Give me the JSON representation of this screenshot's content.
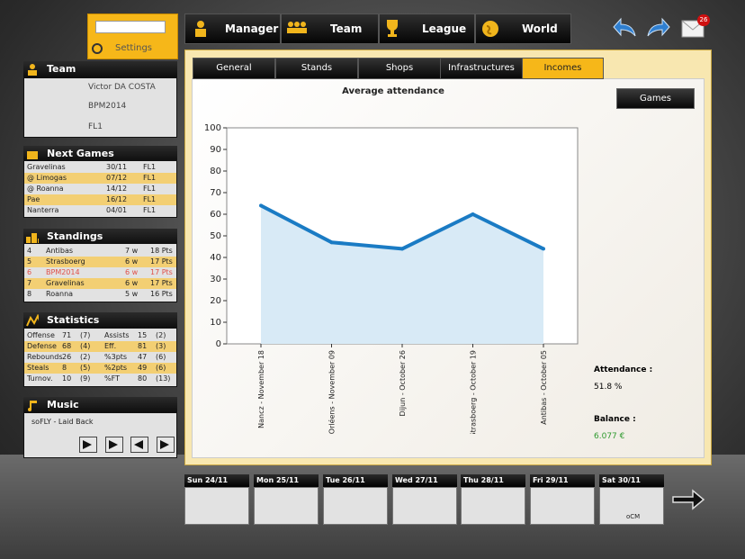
{
  "settings": {
    "label": "Settings"
  },
  "nav": {
    "manager": "Manager",
    "team": "Team",
    "league": "League",
    "world": "World"
  },
  "mail": {
    "count": "26"
  },
  "team_panel": {
    "title": "Team",
    "manager_name": "Victor DA COSTA",
    "team_name": "BPM2014",
    "league": "FL1"
  },
  "next_games": {
    "title": "Next Games",
    "rows": [
      {
        "opponent": "Gravelinas",
        "date": "30/11",
        "league": "FL1"
      },
      {
        "opponent": "@ Limogas",
        "date": "07/12",
        "league": "FL1"
      },
      {
        "opponent": "@ Roanna",
        "date": "14/12",
        "league": "FL1"
      },
      {
        "opponent": "Pae",
        "date": "16/12",
        "league": "FL1"
      },
      {
        "opponent": "Nanterra",
        "date": "04/01",
        "league": "FL1"
      }
    ]
  },
  "standings": {
    "title": "Standings",
    "rows": [
      {
        "rank": "4",
        "team": "Antibas",
        "wins": "7 w",
        "pts": "18 Pts"
      },
      {
        "rank": "5",
        "team": "Strasboerg",
        "wins": "6 w",
        "pts": "17 Pts"
      },
      {
        "rank": "6",
        "team": "BPM2014",
        "wins": "6 w",
        "pts": "17 Pts"
      },
      {
        "rank": "7",
        "team": "Gravelinas",
        "wins": "6 w",
        "pts": "17 Pts"
      },
      {
        "rank": "8",
        "team": "Roanna",
        "wins": "5 w",
        "pts": "16 Pts"
      }
    ]
  },
  "statistics": {
    "title": "Statistics",
    "rows": [
      {
        "l": "Offense",
        "v": "71",
        "r": "(7)",
        "l2": "Assists",
        "v2": "15",
        "r2": "(2)"
      },
      {
        "l": "Defense",
        "v": "68",
        "r": "(4)",
        "l2": "Eff.",
        "v2": "81",
        "r2": "(3)"
      },
      {
        "l": "Rebounds",
        "v": "26",
        "r": "(2)",
        "l2": "%3pts",
        "v2": "47",
        "r2": "(6)"
      },
      {
        "l": "Steals",
        "v": "8",
        "r": "(5)",
        "l2": "%2pts",
        "v2": "49",
        "r2": "(6)"
      },
      {
        "l": "Turnov.",
        "v": "10",
        "r": "(9)",
        "l2": "%FT",
        "v2": "80",
        "r2": "(13)"
      }
    ]
  },
  "music": {
    "title": "Music",
    "track": "soFLY - Laid Back"
  },
  "tabs": [
    "General",
    "Stands",
    "Shops",
    "Infrastructures",
    "Incomes"
  ],
  "games_button": "Games",
  "summary": {
    "attendance_label": "Attendance :",
    "attendance_value": "51.8 %",
    "balance_label": "Balance :",
    "balance_value": "6.077 €"
  },
  "chart_data": {
    "type": "area",
    "title": "Average attendance",
    "categories": [
      "Nancz - November 18",
      "Orléens - November 09",
      "Dijun - October 26",
      "Strasboerg - October 19",
      "Antibas - October 05"
    ],
    "values": [
      64,
      47,
      44,
      60,
      44
    ],
    "ylim": [
      0,
      100
    ],
    "yticks": [
      "0",
      "10",
      "20",
      "30",
      "40",
      "50",
      "60",
      "70",
      "80",
      "90",
      "100"
    ],
    "line_color": "#1a7bc4",
    "fill_color": "#d8eaf6"
  },
  "calendar": [
    {
      "day": "Sun 24/11",
      "note": ""
    },
    {
      "day": "Mon 25/11",
      "note": ""
    },
    {
      "day": "Tue 26/11",
      "note": ""
    },
    {
      "day": "Wed 27/11",
      "note": ""
    },
    {
      "day": "Thu 28/11",
      "note": ""
    },
    {
      "day": "Fri 29/11",
      "note": ""
    },
    {
      "day": "Sat 30/11",
      "note": "oCM"
    }
  ]
}
